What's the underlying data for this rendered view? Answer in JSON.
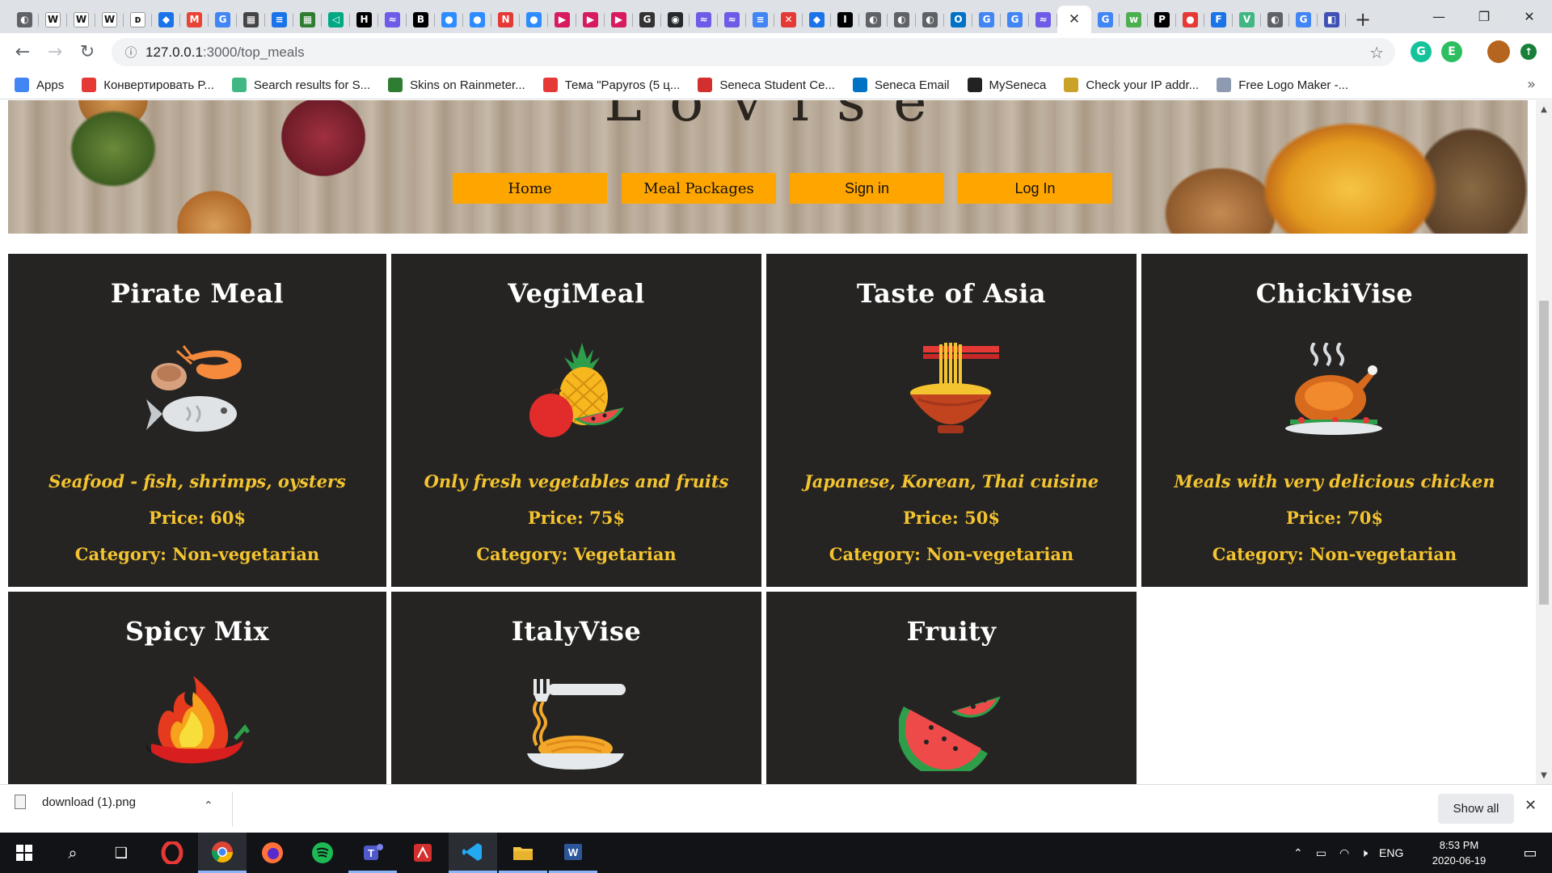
{
  "browser": {
    "tab_favicons": [
      {
        "name": "globe-icon",
        "color": "#5f6368",
        "glyph": "◐"
      },
      {
        "name": "wikipedia-icon",
        "color": "#ffffff",
        "glyph": "W"
      },
      {
        "name": "wikipedia-icon",
        "color": "#ffffff",
        "glyph": "W"
      },
      {
        "name": "wikipedia-icon",
        "color": "#ffffff",
        "glyph": "W"
      },
      {
        "name": "doc-icon",
        "color": "#ffffff",
        "glyph": "ᴅ"
      },
      {
        "name": "rainmeter-icon",
        "color": "#1a73e8",
        "glyph": "◆"
      },
      {
        "name": "gmail-icon",
        "color": "#ea4335",
        "glyph": "M"
      },
      {
        "name": "translate-icon",
        "color": "#4285f4",
        "glyph": "G"
      },
      {
        "name": "image-icon",
        "color": "#444444",
        "glyph": "▦"
      },
      {
        "name": "list-icon",
        "color": "#1a73e8",
        "glyph": "≡"
      },
      {
        "name": "grid-icon",
        "color": "#2e7d32",
        "glyph": "▦"
      },
      {
        "name": "send-icon",
        "color": "#00a884",
        "glyph": "◁"
      },
      {
        "name": "hi-icon",
        "color": "#000000",
        "glyph": "H"
      },
      {
        "name": "meet-icon",
        "color": "#6c5ce7",
        "glyph": "≈"
      },
      {
        "name": "behance-icon",
        "color": "#000000",
        "glyph": "B"
      },
      {
        "name": "zoom-icon",
        "color": "#2d8cff",
        "glyph": "●"
      },
      {
        "name": "zoom-icon",
        "color": "#2d8cff",
        "glyph": "●"
      },
      {
        "name": "notion-icon",
        "color": "#e53935",
        "glyph": "N"
      },
      {
        "name": "zoom-icon",
        "color": "#2d8cff",
        "glyph": "●"
      },
      {
        "name": "play-icon",
        "color": "#d81b60",
        "glyph": "▶"
      },
      {
        "name": "play-icon",
        "color": "#d81b60",
        "glyph": "▶"
      },
      {
        "name": "play-icon",
        "color": "#d81b60",
        "glyph": "▶"
      },
      {
        "name": "g-icon",
        "color": "#333333",
        "glyph": "G"
      },
      {
        "name": "github-icon",
        "color": "#24292e",
        "glyph": "◉"
      },
      {
        "name": "meet-icon",
        "color": "#6c5ce7",
        "glyph": "≈"
      },
      {
        "name": "meet-icon",
        "color": "#6c5ce7",
        "glyph": "≈"
      },
      {
        "name": "docs-icon",
        "color": "#4285f4",
        "glyph": "≡"
      },
      {
        "name": "cancel-icon",
        "color": "#e53935",
        "glyph": "✕"
      },
      {
        "name": "rainmeter-icon",
        "color": "#1a73e8",
        "glyph": "◆"
      },
      {
        "name": "ict-icon",
        "color": "#000000",
        "glyph": "I"
      },
      {
        "name": "globe-icon",
        "color": "#5f6368",
        "glyph": "◐"
      },
      {
        "name": "globe-icon",
        "color": "#5f6368",
        "glyph": "◐"
      },
      {
        "name": "globe-icon",
        "color": "#5f6368",
        "glyph": "◐"
      },
      {
        "name": "outlook-icon",
        "color": "#0072c6",
        "glyph": "O"
      },
      {
        "name": "google-icon",
        "color": "#4285f4",
        "glyph": "G"
      },
      {
        "name": "google-icon",
        "color": "#4285f4",
        "glyph": "G"
      },
      {
        "name": "meet-icon",
        "color": "#6c5ce7",
        "glyph": "≈"
      }
    ],
    "active_tab_close": "✕",
    "tab_favicons_after": [
      {
        "name": "google-icon",
        "color": "#4285f4",
        "glyph": "G"
      },
      {
        "name": "w3-icon",
        "color": "#4caf50",
        "glyph": "w"
      },
      {
        "name": "ip-icon",
        "color": "#000000",
        "glyph": "P"
      },
      {
        "name": "opera-icon",
        "color": "#e53935",
        "glyph": "●"
      },
      {
        "name": "f-icon",
        "color": "#1a73e8",
        "glyph": "F"
      },
      {
        "name": "vue-icon",
        "color": "#41b883",
        "glyph": "V"
      },
      {
        "name": "globe-icon",
        "color": "#5f6368",
        "glyph": "◐"
      },
      {
        "name": "google-icon",
        "color": "#4285f4",
        "glyph": "G"
      },
      {
        "name": "app-icon",
        "color": "#3f51b5",
        "glyph": "◧"
      }
    ],
    "new_tab": "+",
    "window_controls": {
      "minimize": "—",
      "restore": "❐",
      "close": "✕"
    },
    "url_host": "127.0.0.1",
    "url_path": ":3000/top_meals",
    "bookmarks": [
      {
        "label": "Apps",
        "icon": "apps-icon",
        "color": "#4285f4"
      },
      {
        "label": "Конвертировать P...",
        "icon": "convert-icon",
        "color": "#e53935"
      },
      {
        "label": "Search results for S...",
        "icon": "vue-icon",
        "color": "#41b883"
      },
      {
        "label": "Skins on Rainmeter...",
        "icon": "leaf-icon",
        "color": "#2e7d32"
      },
      {
        "label": "Тема \"Papyros (5 ц...",
        "icon": "topic-icon",
        "color": "#e53935"
      },
      {
        "label": "Seneca Student Ce...",
        "icon": "seneca-icon",
        "color": "#d32f2f"
      },
      {
        "label": "Seneca Email",
        "icon": "outlook-icon",
        "color": "#0072c6"
      },
      {
        "label": "MySeneca",
        "icon": "bb-icon",
        "color": "#222222"
      },
      {
        "label": "Check your IP addr...",
        "icon": "ip-icon",
        "color": "#c9a227"
      },
      {
        "label": "Free Logo Maker -...",
        "icon": "logo-maker-icon",
        "color": "#8e9aaf"
      }
    ],
    "bookmarks_more": "»"
  },
  "site": {
    "nav": [
      {
        "label": "Home"
      },
      {
        "label": "Meal Packages"
      },
      {
        "label": "Sign in"
      },
      {
        "label": "Log In"
      }
    ],
    "meals": [
      {
        "title": "Pirate Meal",
        "icon": "seafood-icon",
        "desc": "Seafood - fish, shrimps, oysters",
        "price": "Price: 60$",
        "category": "Category: Non-vegetarian"
      },
      {
        "title": "VegiMeal",
        "icon": "fruit-icon",
        "desc": "Only fresh vegetables and fruits",
        "price": "Price: 75$",
        "category": "Category: Vegetarian"
      },
      {
        "title": "Taste of Asia",
        "icon": "noodle-bowl-icon",
        "desc": "Japanese, Korean, Thai cuisine",
        "price": "Price: 50$",
        "category": "Category: Non-vegetarian"
      },
      {
        "title": "ChickiVise",
        "icon": "roast-chicken-icon",
        "desc": "Meals with very delicious chicken",
        "price": "Price: 70$",
        "category": "Category: Non-vegetarian"
      },
      {
        "title": "Spicy Mix",
        "icon": "chili-fire-icon",
        "desc": "",
        "price": "",
        "category": ""
      },
      {
        "title": "ItalyVise",
        "icon": "pasta-icon",
        "desc": "",
        "price": "",
        "category": ""
      },
      {
        "title": "Fruity",
        "icon": "watermelon-icon",
        "desc": "",
        "price": "",
        "category": ""
      }
    ]
  },
  "downloads": {
    "file": "download (1).png",
    "show_all": "Show all"
  },
  "taskbar": {
    "lang": "ENG",
    "time": "8:53 PM",
    "date": "2020-06-19"
  }
}
